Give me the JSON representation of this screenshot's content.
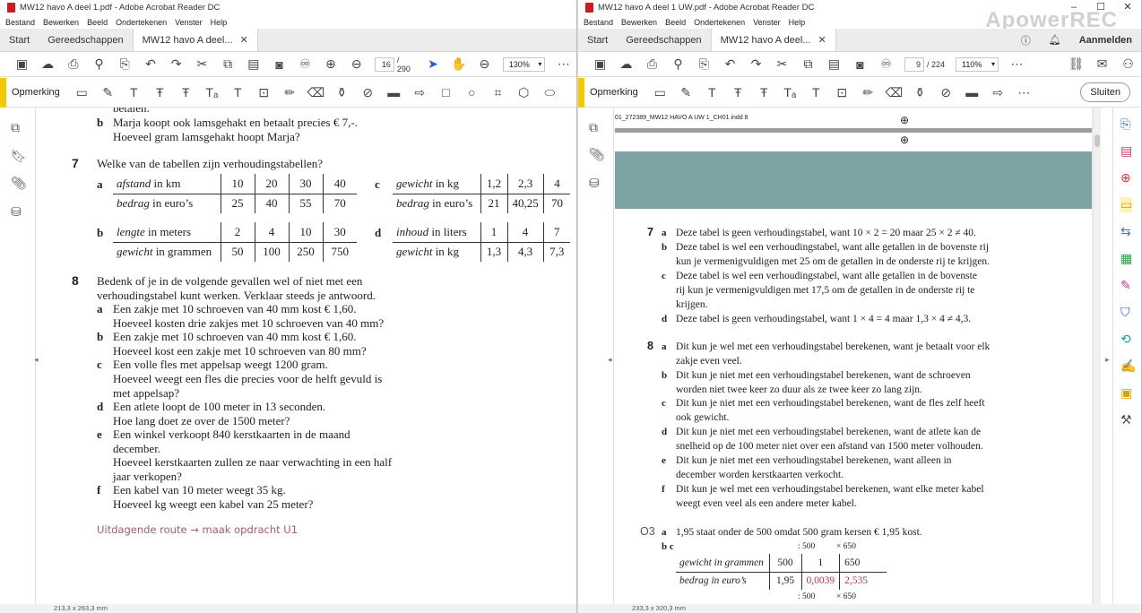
{
  "left": {
    "title": "MW12 havo A deel 1.pdf - Adobe Acrobat Reader DC",
    "menu": [
      "Bestand",
      "Bewerken",
      "Beeld",
      "Ondertekenen",
      "Venster",
      "Help"
    ],
    "tabs": {
      "start": "Start",
      "tools": "Gereedschappen",
      "doc": "MW12 havo A deel..."
    },
    "page_current": "16",
    "page_total": "/ 290",
    "zoom": "130%",
    "annot_label": "Opmerking",
    "status": "213,3 x 263,3 mm",
    "doc": {
      "top_cut": "betalen.",
      "q6b_1": "Marja koopt ook lamsgehakt en betaalt precies € 7,-.",
      "q6b_2": "Hoeveel gram lamsgehakt hoopt Marja?",
      "q7_num": "7",
      "q7_text": "Welke van de tabellen zijn verhoudingstabellen?",
      "tab_a": {
        "l": "a",
        "r1h_i": "afstand",
        "r1h": " in km",
        "r1": [
          "10",
          "20",
          "30",
          "40"
        ],
        "r2h_i": "bedrag",
        "r2h": " in euro’s",
        "r2": [
          "25",
          "40",
          "55",
          "70"
        ]
      },
      "tab_b": {
        "l": "b",
        "r1h_i": "lengte",
        "r1h": " in meters",
        "r1": [
          "2",
          "4",
          "10",
          "30"
        ],
        "r2h_i": "gewicht",
        "r2h": " in grammen",
        "r2": [
          "50",
          "100",
          "250",
          "750"
        ]
      },
      "tab_c": {
        "l": "c",
        "r1h_i": "gewicht",
        "r1h": " in kg",
        "r1": [
          "1,2",
          "2,3",
          "4"
        ],
        "r2h_i": "bedrag",
        "r2h": " in euro’s",
        "r2": [
          "21",
          "40,25",
          "70"
        ]
      },
      "tab_d": {
        "l": "d",
        "r1h_i": "inhoud",
        "r1h": " in liters",
        "r1": [
          "1",
          "4",
          "7"
        ],
        "r2h_i": "gewicht",
        "r2h": " in kg",
        "r2": [
          "1,3",
          "4,3",
          "7,3"
        ]
      },
      "q8_num": "8",
      "q8_1": "Bedenk of je in de volgende gevallen wel of niet met een",
      "q8_2": "verhoudingstabel kunt werken. Verklaar steeds je antwoord.",
      "q8a_1": "Een zakje met 10 schroeven van 40 mm kost € 1,60.",
      "q8a_2": "Hoeveel kosten drie zakjes met 10 schroeven van 40 mm?",
      "q8b_1": "Een zakje met 10 schroeven van 40 mm kost € 1,60.",
      "q8b_2": "Hoeveel kost een zakje met 10 schroeven van 80 mm?",
      "q8c_1": "Een volle fles met appelsap weegt 1200 gram.",
      "q8c_2": "Hoeveel weegt een fles die precies voor de helft gevuld is",
      "q8c_3": "met appelsap?",
      "q8d_1": "Een atlete loopt de 100 meter in 13 seconden.",
      "q8d_2": "Hoe lang doet ze over de 1500 meter?",
      "q8e_1": "Een winkel verkoopt 840 kerstkaarten in de maand",
      "q8e_2": "december.",
      "q8e_3": "Hoeveel kerstkaarten zullen ze naar verwachting in een half",
      "q8e_4": "jaar verkopen?",
      "q8f_1": "Een kabel van 10 meter weegt 35 kg.",
      "q8f_2": "Hoeveel kg weegt een kabel van 25 meter?",
      "route": "Uitdagende route → maak opdracht U1",
      "letters": {
        "a": "a",
        "b": "b",
        "c": "c",
        "d": "d",
        "e": "e",
        "f": "f"
      }
    }
  },
  "right": {
    "title": "MW12 havo A deel 1 UW.pdf - Adobe Acrobat Reader DC",
    "menu": [
      "Bestand",
      "Bewerken",
      "Beeld",
      "Ondertekenen",
      "Venster",
      "Help"
    ],
    "tabs": {
      "start": "Start",
      "tools": "Gereedschappen",
      "doc": "MW12 havo A deel..."
    },
    "signin": "Aanmelden",
    "page_current": "9",
    "page_total": "/ 224",
    "zoom": "110%",
    "annot_label": "Opmerking",
    "close_label": "Sluiten",
    "status": "233,3 x 320,3 mm",
    "watermark": "ApowerREC",
    "doc": {
      "header": "01_272389_MW12 HAVO A UW 1_CH01.indd   8",
      "a7_num": "7",
      "a7a": "Deze tabel is geen verhoudingstabel, want 10 × 2 = 20 maar 25 × 2 ≠ 40.",
      "a7b_1": "Deze tabel is wel een verhoudingstabel, want alle getallen in de bovenste rij",
      "a7b_2": "kun je vermenigvuldigen met 25 om de getallen in de onderste rij te krijgen.",
      "a7c_1": "Deze tabel is wel een verhoudingstabel, want alle getallen in de bovenste",
      "a7c_2": "rij kun je vermenigvuldigen met 17,5 om de getallen in de onderste rij te",
      "a7c_3": "krijgen.",
      "a7d": "Deze tabel is geen verhoudingstabel, want 1 × 4 = 4 maar 1,3 × 4 ≠ 4,3.",
      "a8_num": "8",
      "a8a_1": "Dit kun je wel met een verhoudingstabel berekenen, want je betaalt voor elk",
      "a8a_2": "zakje even veel.",
      "a8b_1": "Dit kun je niet met een verhoudingstabel berekenen, want de schroeven",
      "a8b_2": "worden niet twee keer zo duur als ze twee keer zo lang zijn.",
      "a8c_1": "Dit kun je niet met een verhoudingstabel berekenen, want de fles zelf heeft",
      "a8c_2": "ook gewicht.",
      "a8d_1": "Dit kun je niet met een verhoudingstabel berekenen, want de atlete kan de",
      "a8d_2": "snelheid op de 100 meter niet over een afstand van 1500 meter volhouden.",
      "a8e_1": "Dit kun je niet met een verhoudingstabel berekenen, want alleen in",
      "a8e_2": "december worden kerstkaarten verkocht.",
      "a8f_1": "Dit kun je wel met een verhoudingstabel berekenen, want elke meter kabel",
      "a8f_2": "weegt even veel als een andere meter kabel.",
      "o3_num": "O3",
      "o3a": "1,95 staat onder de 500 omdat 500 gram kersen € 1,95 kost.",
      "o3bc": "b  c",
      "o3_table": {
        "r1h": "gewicht in grammen",
        "r1": [
          "500",
          "1",
          "650"
        ],
        "r2h": "bedrag in euro’s",
        "r2": [
          "1,95",
          "0,0039",
          "2,535"
        ]
      },
      "o3_top": [
        ": 500",
        "× 650"
      ],
      "o3_bot": [
        ": 500",
        "× 650"
      ],
      "letters": {
        "a": "a",
        "b": "b",
        "c": "c",
        "d": "d",
        "e": "e",
        "f": "f"
      }
    }
  },
  "colors": {
    "accent_yellow": "#f7c700",
    "route_color": "#a65d6a",
    "answer_red": "#b2375a",
    "banner": "#7ea3a5"
  }
}
